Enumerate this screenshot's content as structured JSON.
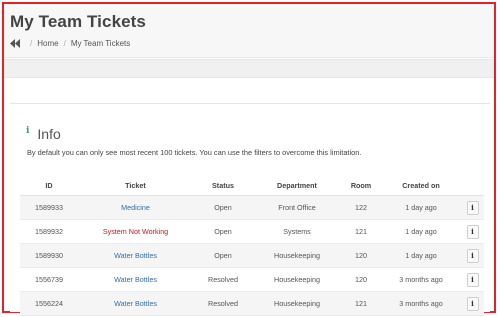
{
  "header": {
    "title": "My Team Tickets",
    "breadcrumb": {
      "home": "Home",
      "separator": "/",
      "current": "My Team Tickets"
    }
  },
  "info": {
    "icon": "info-icon",
    "title": "Info",
    "text": "By default you can only see most recent 100 tickets. You can use the filters to overcome this limitation."
  },
  "table": {
    "columns": [
      "ID",
      "Ticket",
      "Status",
      "Department",
      "Room",
      "Created on",
      ""
    ],
    "rows": [
      {
        "id": "1589933",
        "ticket": "Medicine",
        "ticket_color": "#2f6fb0",
        "status": "Open",
        "department": "Front Office",
        "room": "122",
        "created": "1 day ago",
        "action_icon": "i"
      },
      {
        "id": "1589932",
        "ticket": "System Not Working",
        "ticket_color": "#d0141e",
        "status": "Open",
        "department": "Systems",
        "room": "121",
        "created": "1 day ago",
        "action_icon": "i"
      },
      {
        "id": "1589930",
        "ticket": "Water Bottles",
        "ticket_color": "#2f6fb0",
        "status": "Open",
        "department": "Housekeeping",
        "room": "120",
        "created": "1 day ago",
        "action_icon": "i"
      },
      {
        "id": "1556739",
        "ticket": "Water Bottles",
        "ticket_color": "#2f6fb0",
        "status": "Resolved",
        "department": "Housekeeping",
        "room": "120",
        "created": "3 months ago",
        "action_icon": "i"
      },
      {
        "id": "1556224",
        "ticket": "Water Bottles",
        "ticket_color": "#2f6fb0",
        "status": "Resolved",
        "department": "Housekeeping",
        "room": "121",
        "created": "3 months ago",
        "action_icon": "i"
      }
    ]
  },
  "colors": {
    "frame": "#e8202a",
    "link": "#2f6fb0",
    "alert_link": "#d0141e",
    "info_icon": "#3a9a8a"
  }
}
